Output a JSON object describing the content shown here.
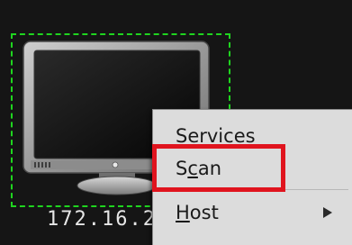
{
  "host": {
    "ip_label": "172.16.2",
    "icon": "monitor-icon"
  },
  "context_menu": {
    "items": [
      {
        "label": "Services",
        "mnemonic": ""
      },
      {
        "label_pre": "S",
        "mnemonic": "c",
        "label_post": "an"
      },
      {
        "label_pre": "",
        "mnemonic": "H",
        "label_post": "ost",
        "submenu_icon": "chevron-right-icon"
      }
    ]
  },
  "colors": {
    "background": "#151515",
    "selection_frame": "#1fd51f",
    "highlight": "#e0141e",
    "menu_bg": "#dcdcdc"
  }
}
